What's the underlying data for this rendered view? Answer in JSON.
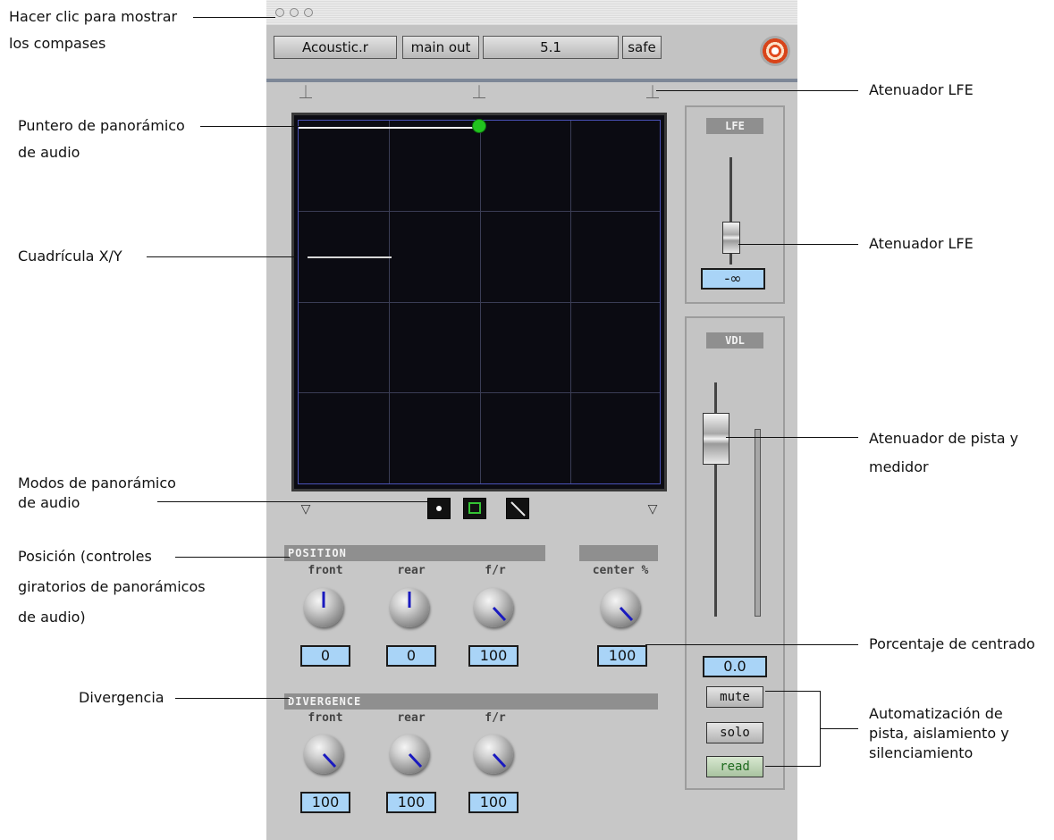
{
  "toolbar": {
    "insert_name": "Acoustic.r",
    "output": "main out",
    "format": "5.1",
    "safe_label": "safe",
    "target_icon": "target-icon"
  },
  "panner": {
    "modes": [
      "point-mode-icon",
      "square-mode-icon",
      "diagonal-mode-icon"
    ]
  },
  "position": {
    "title": "POSITION",
    "knobs": [
      {
        "label": "front",
        "value": "0"
      },
      {
        "label": "rear",
        "value": "0"
      },
      {
        "label": "f/r",
        "value": "100"
      }
    ],
    "center": {
      "label": "center %",
      "value": "100"
    }
  },
  "divergence": {
    "title": "DIVERGENCE",
    "knobs": [
      {
        "label": "front",
        "value": "100"
      },
      {
        "label": "rear",
        "value": "100"
      },
      {
        "label": "f/r",
        "value": "100"
      }
    ]
  },
  "lfe": {
    "title": "LFE",
    "value": "-∞"
  },
  "vdl": {
    "title": "VDL",
    "value": "0.0"
  },
  "buttons": {
    "mute": "mute",
    "solo": "solo",
    "read": "read"
  },
  "callouts": {
    "bars": "Hacer clic para mostrar",
    "bars_2": "los compases",
    "pointer": "Puntero de panorámico",
    "pointer_2": "de audio",
    "grid": "Cuadrícula X/Y",
    "modes": "Modos de panorámico",
    "modes_2": "de audio",
    "position": "Posición (controles",
    "position_2": "giratorios de panorámicos",
    "position_3": "de audio)",
    "divergence": "Divergencia",
    "lfe_top": "Atenuador LFE",
    "lfe_fader": "Atenuador LFE",
    "track_fader": "Atenuador de pista y",
    "track_fader_2": "medidor",
    "center_pct": "Porcentaje de centrado",
    "automation": "Automatización de",
    "automation_2": "pista, aislamiento y",
    "automation_3": "silenciamiento"
  },
  "colors": {
    "panner_bg": "#0b0b12",
    "cursor": "#21c21f",
    "value_box": "#a9d4f7",
    "read_text": "#1f6b1f"
  }
}
